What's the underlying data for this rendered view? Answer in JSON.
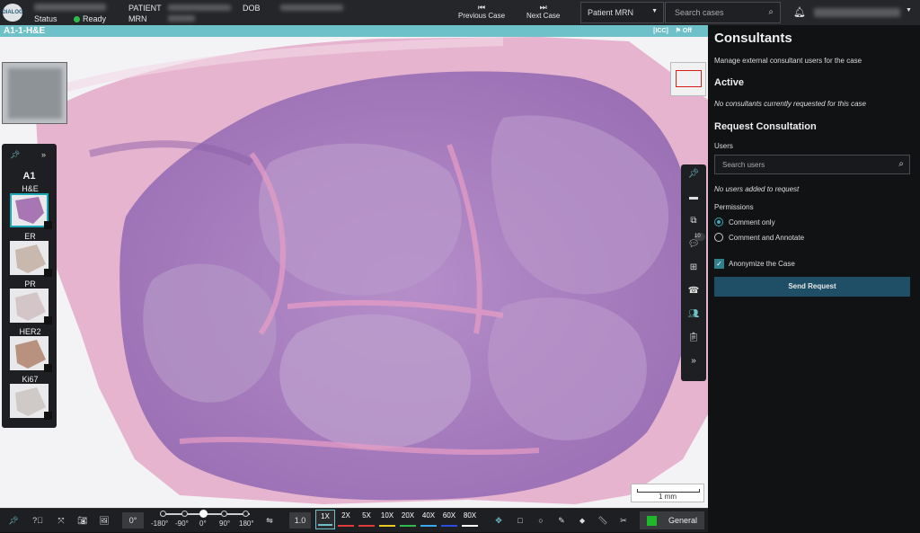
{
  "header": {
    "logo_text": "DIALOG",
    "status_label": "Status",
    "status_value": "Ready",
    "patient_label_1": "PATIENT",
    "patient_label_2": "MRN",
    "dob_label": "DOB",
    "previous_case": "Previous Case",
    "next_case": "Next Case",
    "mrn_select": "Patient MRN",
    "search_placeholder": "Search cases"
  },
  "viewer": {
    "slide_title": "A1-1-H&E",
    "icc_label": "[ICC]",
    "off_label": "Off",
    "scale_label": "1 mm"
  },
  "slides": {
    "group": "A1",
    "items": [
      {
        "label": "H&E",
        "selected": true,
        "color": "#a877b3"
      },
      {
        "label": "ER",
        "selected": false,
        "color": "#c9b8ae"
      },
      {
        "label": "PR",
        "selected": false,
        "color": "#d4c6c8"
      },
      {
        "label": "HER2",
        "selected": false,
        "color": "#b8927e"
      },
      {
        "label": "Ki67",
        "selected": false,
        "color": "#cfc9c8"
      }
    ]
  },
  "right_toolbar": {
    "badge": "10"
  },
  "bottom_toolbar": {
    "rotation_value": "0°",
    "rotation_ticks": [
      "-180°",
      "-90°",
      "0°",
      "90°",
      "180°"
    ],
    "zoom_value": "1.0",
    "magnifications": [
      {
        "label": "1X",
        "color": "#6ec0c9",
        "selected": true
      },
      {
        "label": "2X",
        "color": "#e23b3b",
        "selected": false
      },
      {
        "label": "5X",
        "color": "#e23b3b",
        "selected": false
      },
      {
        "label": "10X",
        "color": "#e6c822",
        "selected": false
      },
      {
        "label": "20X",
        "color": "#2ebd4d",
        "selected": false
      },
      {
        "label": "40X",
        "color": "#3aa9e8",
        "selected": false
      },
      {
        "label": "60X",
        "color": "#2d4de0",
        "selected": false
      },
      {
        "label": "80X",
        "color": "#ffffff",
        "selected": false
      }
    ],
    "general_label": "General"
  },
  "panel": {
    "title": "Consultants",
    "subtitle": "Manage external consultant users for the case",
    "active_heading": "Active",
    "active_empty": "No consultants currently requested for this case",
    "request_heading": "Request Consultation",
    "users_label": "Users",
    "users_placeholder": "Search users",
    "users_empty": "No users added to request",
    "permissions_label": "Permissions",
    "permission_options": [
      "Comment only",
      "Comment and Annotate"
    ],
    "anonymize_label": "Anonymize the Case",
    "send_button": "Send Request"
  },
  "colors": {
    "accent": "#6ec0c9",
    "ready": "#2ebd4d",
    "send_button": "#1e4f66"
  }
}
